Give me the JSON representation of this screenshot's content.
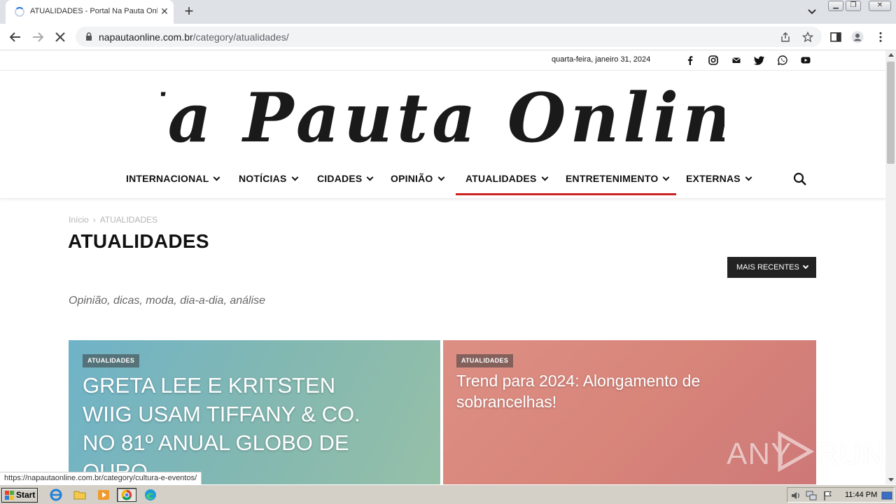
{
  "browser": {
    "tab_title": "ATUALIDADES - Portal Na Pauta Online",
    "url_host": "napautaonline.com.br",
    "url_path": "/category/atualidades/",
    "status_url": "https://napautaonline.com.br/category/cultura-e-eventos/"
  },
  "site": {
    "date": "quarta-feira, janeiro 31, 2024",
    "logo_text": "Na Pauta Online",
    "social_icons": [
      "facebook-icon",
      "instagram-icon",
      "email-icon",
      "twitter-icon",
      "whatsapp-icon",
      "youtube-icon"
    ],
    "menu": [
      {
        "label": "INTERNACIONAL"
      },
      {
        "label": "NOTÍCIAS"
      },
      {
        "label": "CIDADES"
      },
      {
        "label": "OPINIÃO"
      },
      {
        "label": "ATUALIDADES",
        "active": true
      },
      {
        "label": "ENTRETENIMENTO"
      },
      {
        "label": "EXTERNAS"
      }
    ],
    "accent_color": "#cc2222"
  },
  "page": {
    "breadcrumb_home": "Início",
    "breadcrumb_current": "ATUALIDADES",
    "title": "ATUALIDADES",
    "sort_label": "MAIS RECENTES",
    "description": "Opinião, dicas, moda, dia-a-dia, análise"
  },
  "cards": [
    {
      "category": "ATUALIDADES",
      "title": "GRETA LEE E KRITSTEN WIIG USAM TIFFANY & CO. NO 81º ANUAL GLOBO DE OURO"
    },
    {
      "category": "ATUALIDADES",
      "title": "Trend para 2024: Alongamento de sobrancelhas!"
    }
  ],
  "watermark": {
    "left": "ANY",
    "right": "RUN"
  },
  "taskbar": {
    "start_label": "Start",
    "clock": "11:44 PM"
  }
}
